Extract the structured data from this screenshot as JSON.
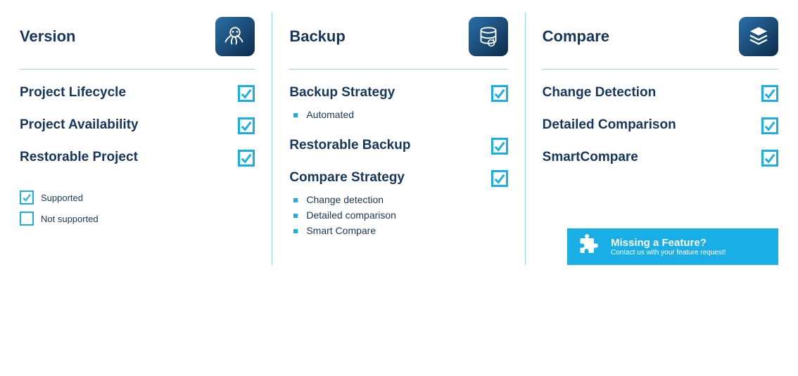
{
  "columns": [
    {
      "title": "Version",
      "icon": "octopus",
      "features": [
        {
          "title": "Project Lifecycle",
          "checked": true,
          "sub": []
        },
        {
          "title": "Project Availability",
          "checked": true,
          "sub": []
        },
        {
          "title": "Restorable Project",
          "checked": true,
          "sub": []
        }
      ]
    },
    {
      "title": "Backup",
      "icon": "database",
      "features": [
        {
          "title": "Backup Strategy",
          "checked": true,
          "sub": [
            "Automated"
          ]
        },
        {
          "title": "Restorable Backup",
          "checked": true,
          "sub": []
        },
        {
          "title": "Compare Strategy",
          "checked": true,
          "sub": [
            "Change detection",
            "Detailed comparison",
            "Smart Compare"
          ]
        }
      ]
    },
    {
      "title": "Compare",
      "icon": "layers",
      "features": [
        {
          "title": "Change Detection",
          "checked": true,
          "sub": []
        },
        {
          "title": "Detailed Comparison",
          "checked": true,
          "sub": []
        },
        {
          "title": "SmartCompare",
          "checked": true,
          "sub": []
        }
      ]
    }
  ],
  "legend": {
    "supported": "Supported",
    "not_supported": "Not supported"
  },
  "cta": {
    "title": "Missing a Feature?",
    "subtitle": "Contact us with your feature request!"
  }
}
